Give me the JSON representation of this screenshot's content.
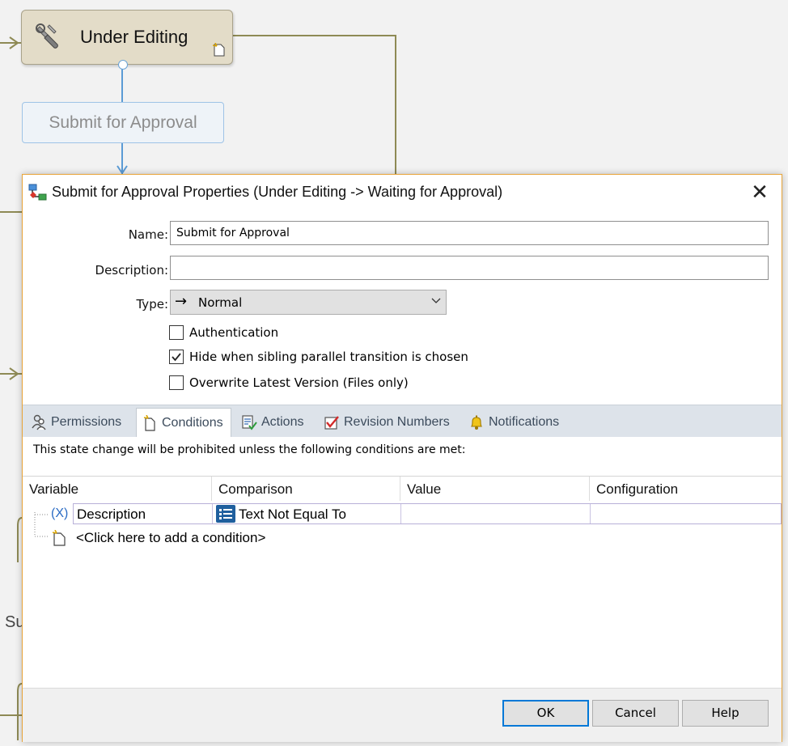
{
  "canvas": {
    "state_title": "Under Editing",
    "transition_label": "Submit for Approval",
    "partial_text": "Su"
  },
  "dialog": {
    "title": "Submit for Approval Properties (Under Editing -> Waiting for Approval)",
    "close_glyph": "✕",
    "name_label": "Name:",
    "name_value": "Submit for Approval",
    "description_label": "Description:",
    "description_value": "",
    "type_label": "Type:",
    "type_arrow": "→",
    "type_value": "Normal",
    "checkboxes": [
      {
        "label": "Authentication",
        "checked": false
      },
      {
        "label": "Hide when sibling parallel transition is chosen",
        "checked": true
      },
      {
        "label": "Overwrite Latest Version (Files only)",
        "checked": false
      }
    ],
    "tabs": [
      {
        "label": "Permissions",
        "icon": "users-icon"
      },
      {
        "label": "Conditions",
        "icon": "document-icon",
        "active": true
      },
      {
        "label": "Actions",
        "icon": "actions-icon"
      },
      {
        "label": "Revision Numbers",
        "icon": "checkmark-box-icon"
      },
      {
        "label": "Notifications",
        "icon": "bell-icon"
      }
    ],
    "conditions": {
      "info": "This state change will be prohibited unless the following conditions are met:",
      "columns": [
        "Variable",
        "Comparison",
        "Value",
        "Configuration"
      ],
      "variable_prefix": "(X)",
      "rows": [
        {
          "variable": "Description",
          "comparison": "Text Not Equal To",
          "value": "",
          "configuration": ""
        }
      ],
      "add_prompt": "<Click here to add a condition>"
    },
    "buttons": {
      "ok": "OK",
      "cancel": "Cancel",
      "help": "Help"
    }
  }
}
